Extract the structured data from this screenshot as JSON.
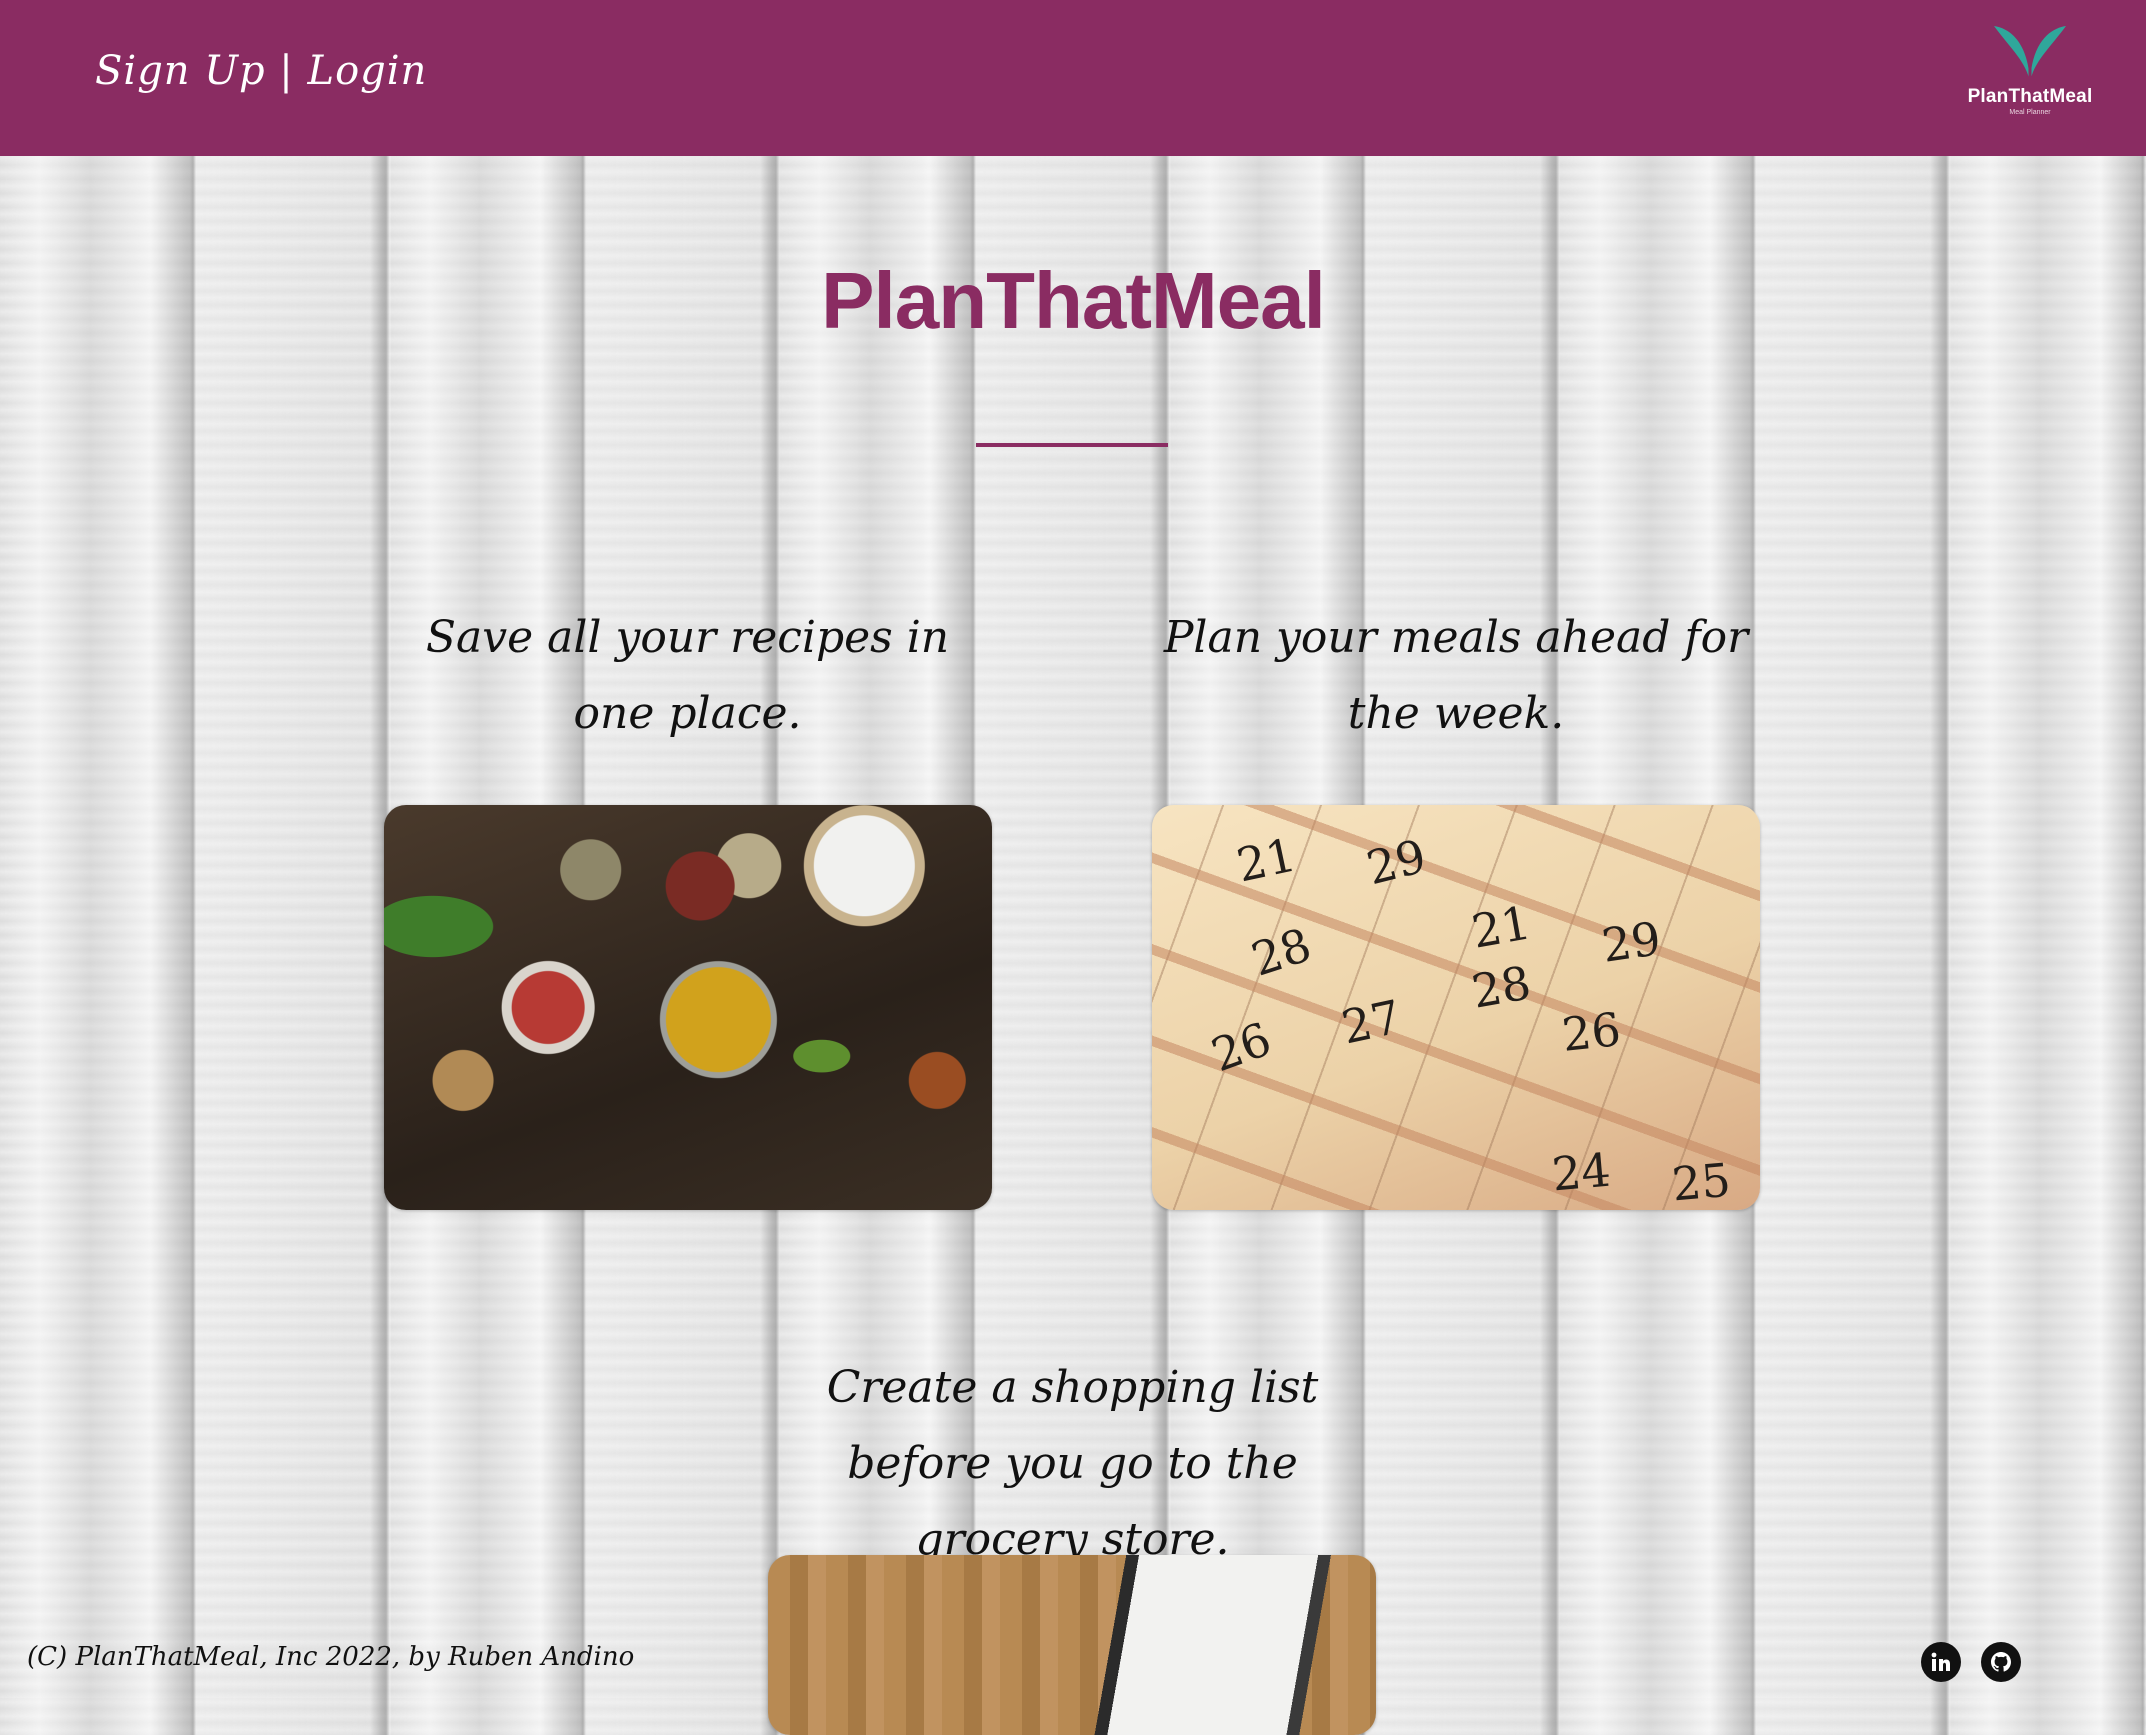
{
  "nav": {
    "signup_login": "Sign Up | Login"
  },
  "logo": {
    "name": "PlanThatMeal",
    "tagline": "Meal Planner",
    "leaf_color": "#2fa79b"
  },
  "hero": {
    "title": "PlanThatMeal"
  },
  "features": [
    {
      "text": "Save all your recipes in one place.",
      "image": "spices-image"
    },
    {
      "text": "Plan your meals ahead for the week.",
      "image": "calendar-image"
    },
    {
      "text": "Create a shopping list before you go to the grocery store.",
      "image": "shopping-list-image"
    }
  ],
  "footer": {
    "copyright": "(C) PlanThatMeal, Inc 2022, by Ruben Andino",
    "social": [
      "linkedin-icon",
      "github-icon"
    ]
  },
  "colors": {
    "brand": "#8a2c62",
    "accent": "#2fa79b",
    "text": "#111111"
  }
}
